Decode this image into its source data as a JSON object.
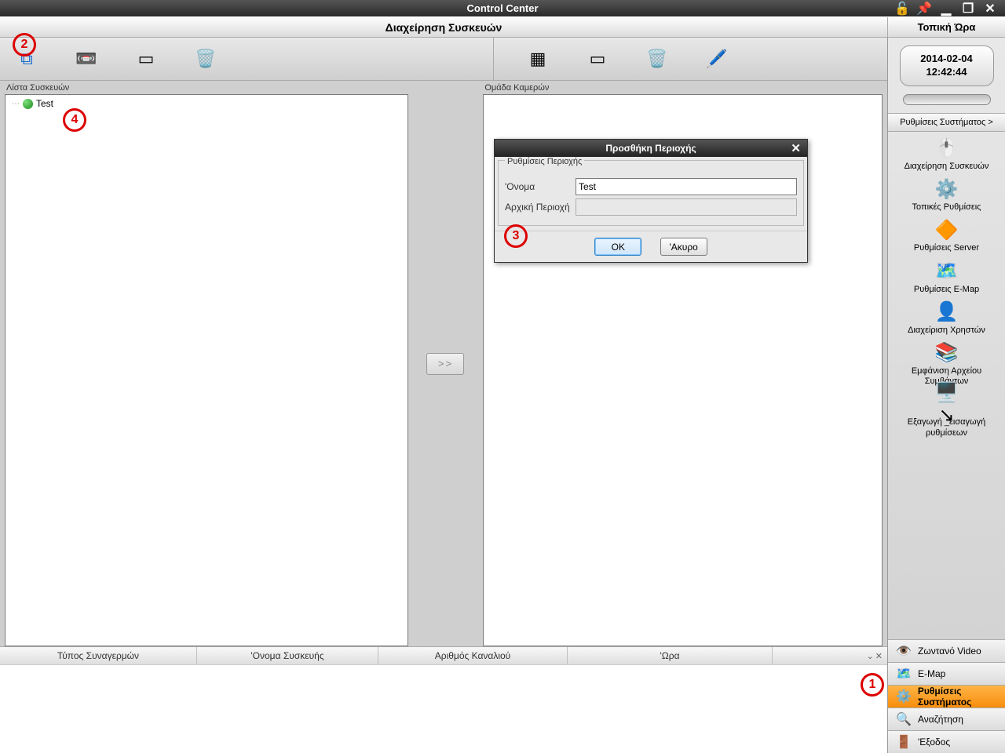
{
  "window": {
    "title": "Control Center"
  },
  "header": {
    "main": "Διαχείρηση Συσκευών",
    "clock": "Τοπική Ώρα"
  },
  "clock": {
    "date": "2014-02-04",
    "time": "12:42:44"
  },
  "panels": {
    "left_title": "Λίστα Συσκευών",
    "right_title": "Ομάδα Καμερών",
    "tree_item_0": "Test",
    "split_label": ">>"
  },
  "dialog": {
    "title": "Προσθήκη Περιοχής",
    "group": "Ρυθμίσεις Περιοχής",
    "name_label": "'Ονομα",
    "name_value": "Test",
    "parent_label": "Αρχική Περιοχή",
    "parent_value": "",
    "ok": "OK",
    "cancel": "'Ακυρο"
  },
  "sys": {
    "header": "Ρυθμίσεις Συστήματος >",
    "items": [
      {
        "icon": "🖱️",
        "label": "Διαχείρηση Συσκευών"
      },
      {
        "icon": "⚙️",
        "label": "Τοπικές Ρυθμίσεις"
      },
      {
        "icon": "🔶",
        "label": "Ρυθμίσεις Server"
      },
      {
        "icon": "🗺️",
        "label": "Ρυθμίσεις E-Map"
      },
      {
        "icon": "👤",
        "label": "Διαχείριση Χρηστών"
      },
      {
        "icon": "📚",
        "label": "Εμφάνιση Αρχείου Συμβάντων"
      },
      {
        "icon": "🖥️↘",
        "label": "Εξαγωγή _εισαγωγή ρυθμίσεων"
      }
    ]
  },
  "nav": [
    {
      "icon": "👁️",
      "label": "Ζωντανό Video"
    },
    {
      "icon": "🗺️",
      "label": "E-Map"
    },
    {
      "icon": "⚙️",
      "label": "Ρυθμίσεις Συστήματος",
      "active": true
    },
    {
      "icon": "🔍",
      "label": "Αναζήτηση"
    },
    {
      "icon": "🚪",
      "label": "'Εξοδος"
    }
  ],
  "alarm_cols": [
    "Τύπος Συναγερμών",
    "'Ονομα Συσκευής",
    "Αριθμός Καναλιού",
    "'Ωρα"
  ],
  "annotations": {
    "a1": "1",
    "a2": "2",
    "a3": "3",
    "a4": "4"
  }
}
